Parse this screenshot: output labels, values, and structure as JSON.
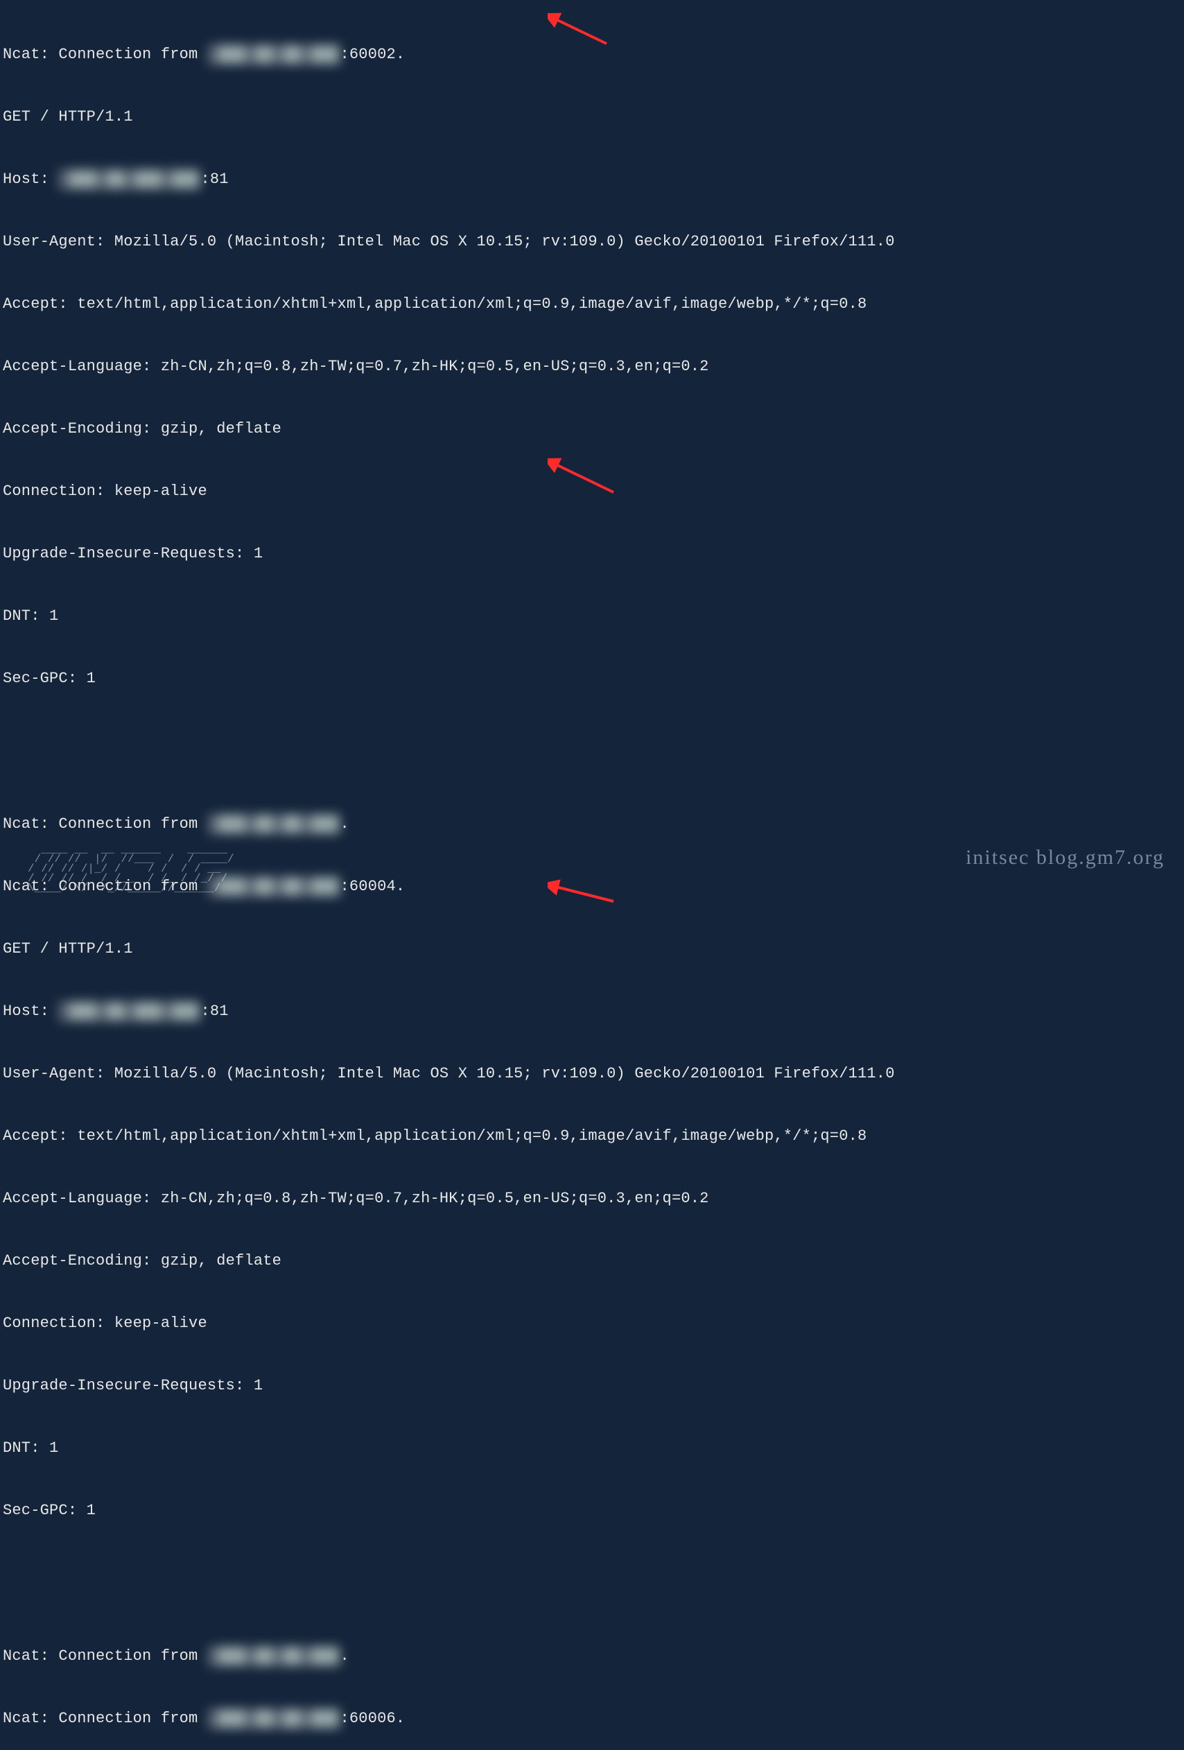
{
  "conn1": {
    "prefix": "Ncat: Connection from ",
    "ip_redacted": " ███.██.██.███",
    "port_suffix": ":60002."
  },
  "req1": {
    "line1": "GET / HTTP/1.1",
    "host_prefix": "Host: ",
    "host_redacted": " ███.██.███.███",
    "host_suffix": ":81",
    "ua": "User-Agent: Mozilla/5.0 (Macintosh; Intel Mac OS X 10.15; rv:109.0) Gecko/20100101 Firefox/111.0",
    "accept": "Accept: text/html,application/xhtml+xml,application/xml;q=0.9,image/avif,image/webp,*/*;q=0.8",
    "acclang": "Accept-Language: zh-CN,zh;q=0.8,zh-TW;q=0.7,zh-HK;q=0.5,en-US;q=0.3,en;q=0.2",
    "accenc": "Accept-Encoding: gzip, deflate",
    "connk": "Connection: keep-alive",
    "uir": "Upgrade-Insecure-Requests: 1",
    "dnt": "DNT: 1",
    "gpc": "Sec-GPC: 1"
  },
  "conn2a": {
    "prefix": "Ncat: Connection from ",
    "ip_redacted": " ███.██.██.███",
    "port_suffix": "."
  },
  "conn2b": {
    "prefix": "Ncat: Connection from ",
    "ip_redacted": " ███.██.██.███",
    "port_suffix": ":60004."
  },
  "req2": {
    "line1": "GET / HTTP/1.1",
    "host_prefix": "Host: ",
    "host_redacted": " ███.██.███.███",
    "host_suffix": ":81",
    "ua": "User-Agent: Mozilla/5.0 (Macintosh; Intel Mac OS X 10.15; rv:109.0) Gecko/20100101 Firefox/111.0",
    "accept": "Accept: text/html,application/xhtml+xml,application/xml;q=0.9,image/avif,image/webp,*/*;q=0.8",
    "acclang": "Accept-Language: zh-CN,zh;q=0.8,zh-TW;q=0.7,zh-HK;q=0.5,en-US;q=0.3,en;q=0.2",
    "accenc": "Accept-Encoding: gzip, deflate",
    "connk": "Connection: keep-alive",
    "uir": "Upgrade-Insecure-Requests: 1",
    "dnt": "DNT: 1",
    "gpc": "Sec-GPC: 1"
  },
  "conn3a": {
    "prefix": "Ncat: Connection from ",
    "ip_redacted": " ███.██.██.███",
    "port_suffix": "."
  },
  "conn3b": {
    "prefix": "Ncat: Connection from ",
    "ip_redacted": " ███.██.██.███",
    "port_suffix": ":60006."
  },
  "watermark": "initsec blog.gm7.org",
  "ascii_wm": "  ____ __  __ ______    ______ \n / // //  |/  //___  /  / ____/\n/ // // /|_/ /    / /  / / __  \n/ // // /  / /___ / /_ / /_/ /  \n\\____/ \\/  /_//_____//______/  "
}
